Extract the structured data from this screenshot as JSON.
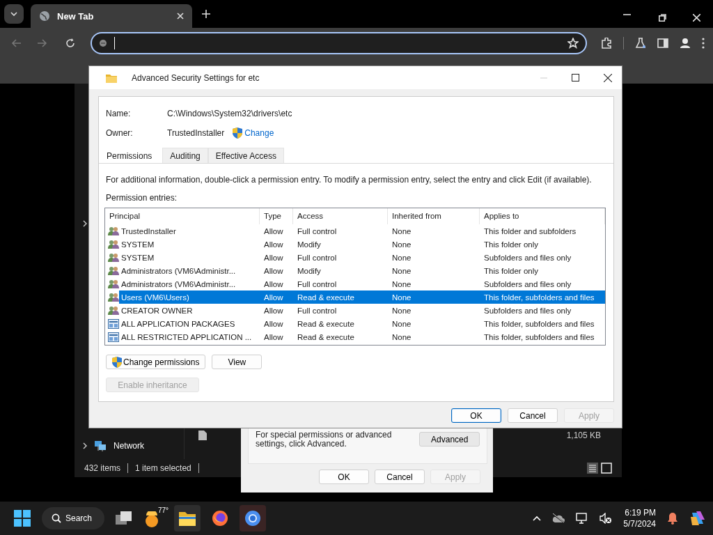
{
  "browser": {
    "tab_title": "New Tab"
  },
  "explorer": {
    "nav_items": [
      {
        "label": "Network"
      }
    ],
    "file_sizes": [
      "1,105 KB"
    ],
    "status": [
      "432 items",
      "1 item selected"
    ]
  },
  "properties_dialog": {
    "hint": "For special permissions or advanced settings, click Advanced.",
    "advanced_button": "Advanced",
    "buttons": [
      {
        "label": "OK",
        "disabled": false
      },
      {
        "label": "Cancel",
        "disabled": false
      },
      {
        "label": "Apply",
        "disabled": true
      }
    ]
  },
  "security_dialog": {
    "title": "Advanced Security Settings for etc",
    "name_label": "Name:",
    "name_value": "C:\\Windows\\System32\\drivers\\etc",
    "owner_label": "Owner:",
    "owner_value": "TrustedInstaller",
    "change_link": "Change",
    "tabs": [
      {
        "label": "Permissions",
        "selected": true
      },
      {
        "label": "Auditing",
        "selected": false
      },
      {
        "label": "Effective Access",
        "selected": false
      }
    ],
    "info": "For additional information, double-click a permission entry. To modify a permission entry, select the entry and click Edit (if available).",
    "entries_label": "Permission entries:",
    "columns": [
      "Principal",
      "Type",
      "Access",
      "Inherited from",
      "Applies to"
    ],
    "rows": [
      {
        "kind": "group",
        "principal": "TrustedInstaller",
        "type": "Allow",
        "access": "Full control",
        "inherited_from": "None",
        "applies_to": "This folder and subfolders",
        "selected": false
      },
      {
        "kind": "group",
        "principal": "SYSTEM",
        "type": "Allow",
        "access": "Modify",
        "inherited_from": "None",
        "applies_to": "This folder only",
        "selected": false
      },
      {
        "kind": "group",
        "principal": "SYSTEM",
        "type": "Allow",
        "access": "Full control",
        "inherited_from": "None",
        "applies_to": "Subfolders and files only",
        "selected": false
      },
      {
        "kind": "group",
        "principal": "Administrators (VM6\\Administr...",
        "type": "Allow",
        "access": "Modify",
        "inherited_from": "None",
        "applies_to": "This folder only",
        "selected": false
      },
      {
        "kind": "group",
        "principal": "Administrators (VM6\\Administr...",
        "type": "Allow",
        "access": "Full control",
        "inherited_from": "None",
        "applies_to": "Subfolders and files only",
        "selected": false
      },
      {
        "kind": "group",
        "principal": "Users (VM6\\Users)",
        "type": "Allow",
        "access": "Read & execute",
        "inherited_from": "None",
        "applies_to": "This folder, subfolders and files",
        "selected": true
      },
      {
        "kind": "group",
        "principal": "CREATOR OWNER",
        "type": "Allow",
        "access": "Full control",
        "inherited_from": "None",
        "applies_to": "Subfolders and files only",
        "selected": false
      },
      {
        "kind": "package",
        "principal": "ALL APPLICATION PACKAGES",
        "type": "Allow",
        "access": "Read & execute",
        "inherited_from": "None",
        "applies_to": "This folder, subfolders and files",
        "selected": false
      },
      {
        "kind": "package",
        "principal": "ALL RESTRICTED APPLICATION ...",
        "type": "Allow",
        "access": "Read & execute",
        "inherited_from": "None",
        "applies_to": "This folder, subfolders and files",
        "selected": false
      }
    ],
    "change_permissions_button": "Change permissions",
    "view_button": "View",
    "inheritance_button": {
      "label": "Enable inheritance",
      "disabled": true
    },
    "buttons": [
      {
        "label": "OK",
        "default": true,
        "disabled": false
      },
      {
        "label": "Cancel",
        "default": false,
        "disabled": false
      },
      {
        "label": "Apply",
        "default": false,
        "disabled": true
      }
    ]
  },
  "taskbar": {
    "search": "Search",
    "weather": "77°",
    "time": "6:19 PM",
    "date": "5/7/2024"
  }
}
